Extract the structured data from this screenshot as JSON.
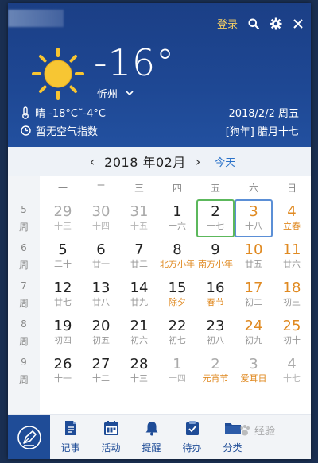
{
  "header": {
    "login_label": "登录",
    "icons": [
      "search-icon",
      "gear-icon",
      "close-icon"
    ],
    "temperature": "-16°",
    "city": "忻州",
    "weather": "晴  -18°C˜-4°C",
    "air_quality": "暂无空气指数",
    "date": "2018/2/2  周五",
    "lunar": "[狗年] 腊月十七"
  },
  "calendar": {
    "month_label": "2018 年02月",
    "prev_label": "‹",
    "next_label": "›",
    "today_label": "今天",
    "weekdays": [
      "一",
      "二",
      "三",
      "四",
      "五",
      "六",
      "日"
    ],
    "week_rows": [
      {
        "week": "5",
        "unit": "周",
        "cells": [
          {
            "d": "29",
            "l": "十三",
            "other": true
          },
          {
            "d": "30",
            "l": "十四",
            "other": true
          },
          {
            "d": "31",
            "l": "十五",
            "other": true
          },
          {
            "d": "1",
            "l": "十六"
          },
          {
            "d": "2",
            "l": "十七",
            "today": true
          },
          {
            "d": "3",
            "l": "十八",
            "selected": true,
            "wkend": true
          },
          {
            "d": "4",
            "l": "立春",
            "wkend": true,
            "holiday": true
          }
        ]
      },
      {
        "week": "6",
        "unit": "周",
        "cells": [
          {
            "d": "5",
            "l": "二十"
          },
          {
            "d": "6",
            "l": "廿一"
          },
          {
            "d": "7",
            "l": "廿二"
          },
          {
            "d": "8",
            "l": "北方小年",
            "holiday": true,
            "wide": true
          },
          {
            "d": "9",
            "l": "南方小年",
            "holiday": true,
            "wide": true
          },
          {
            "d": "10",
            "l": "廿五",
            "wkend": true
          },
          {
            "d": "11",
            "l": "廿六",
            "wkend": true
          }
        ]
      },
      {
        "week": "7",
        "unit": "周",
        "cells": [
          {
            "d": "12",
            "l": "廿七"
          },
          {
            "d": "13",
            "l": "廿八"
          },
          {
            "d": "14",
            "l": "廿九"
          },
          {
            "d": "15",
            "l": "除夕",
            "holiday": true
          },
          {
            "d": "16",
            "l": "春节",
            "holiday": true
          },
          {
            "d": "17",
            "l": "初二",
            "wkend": true
          },
          {
            "d": "18",
            "l": "初三",
            "wkend": true
          }
        ]
      },
      {
        "week": "8",
        "unit": "周",
        "cells": [
          {
            "d": "19",
            "l": "初四"
          },
          {
            "d": "20",
            "l": "初五"
          },
          {
            "d": "21",
            "l": "初六"
          },
          {
            "d": "22",
            "l": "初七"
          },
          {
            "d": "23",
            "l": "初八"
          },
          {
            "d": "24",
            "l": "初九",
            "wkend": true
          },
          {
            "d": "25",
            "l": "初十",
            "wkend": true
          }
        ]
      },
      {
        "week": "9",
        "unit": "周",
        "cells": [
          {
            "d": "26",
            "l": "十一"
          },
          {
            "d": "27",
            "l": "十二"
          },
          {
            "d": "28",
            "l": "十三"
          },
          {
            "d": "1",
            "l": "十四",
            "other": true
          },
          {
            "d": "2",
            "l": "元宵节",
            "other": true,
            "holiday": true
          },
          {
            "d": "3",
            "l": "爱耳日",
            "other": true,
            "holiday": true
          },
          {
            "d": "4",
            "l": "十七",
            "other": true
          }
        ]
      }
    ]
  },
  "toolbar": {
    "items": [
      {
        "label": "记事",
        "icon": "note-icon"
      },
      {
        "label": "活动",
        "icon": "calendar-icon"
      },
      {
        "label": "提醒",
        "icon": "bell-icon"
      },
      {
        "label": "待办",
        "icon": "clipboard-icon"
      },
      {
        "label": "分类",
        "icon": "folder-icon"
      }
    ]
  },
  "watermark": "经验",
  "colors": {
    "header_blue": "#1e4793",
    "accent_orange": "#e08a22",
    "login_yellow": "#f6d064",
    "today_green": "#5cb85c",
    "selected_blue": "#5b8fd6",
    "link_blue": "#2a72c9"
  }
}
